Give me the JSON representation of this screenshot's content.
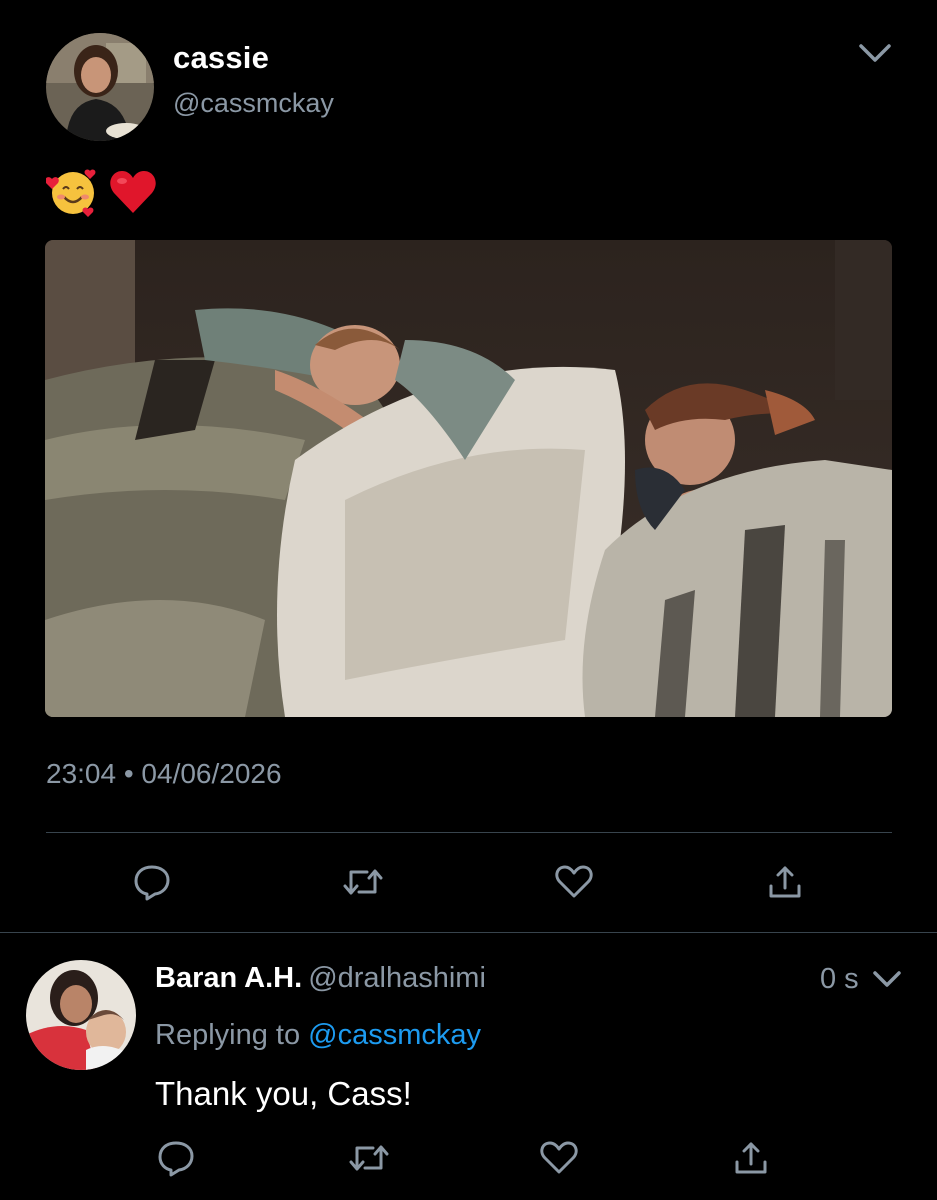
{
  "tweet": {
    "display_name": "cassie",
    "handle": "@cassmckay",
    "emojis": [
      "🥰",
      "❤️"
    ],
    "photo_description_icon": "photo-icon",
    "timestamp": "23:04 • 04/06/2026",
    "actions": [
      "reply-icon",
      "retweet-icon",
      "like-icon",
      "share-icon"
    ]
  },
  "reply": {
    "display_name": "Baran A.H.",
    "handle": "@dralhashimi",
    "age": "0 s",
    "replying_prefix": "Replying to",
    "replying_to": "@cassmckay",
    "text": "Thank you, Cass!",
    "actions": [
      "reply-icon",
      "retweet-icon",
      "like-icon",
      "share-icon"
    ]
  },
  "colors": {
    "background": "#000000",
    "secondary_text": "#8b98a5",
    "link": "#1d9bf0",
    "divider": "#38444d"
  }
}
